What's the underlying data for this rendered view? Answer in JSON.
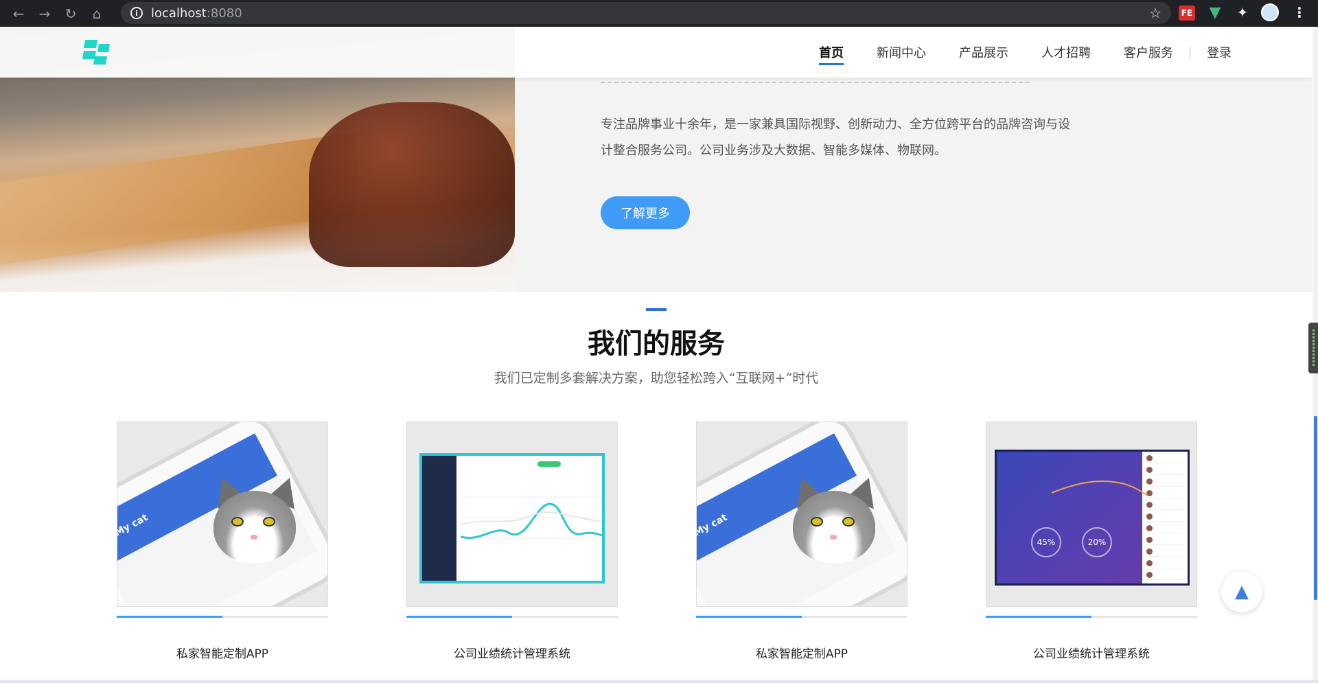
{
  "browser": {
    "url_host": "localhost",
    "url_port": ":8080",
    "ext_fe": "FE"
  },
  "nav": {
    "items": [
      "首页",
      "新闻中心",
      "产品展示",
      "人才招聘",
      "客户服务"
    ],
    "login": "登录"
  },
  "hero": {
    "text": "专注品牌事业十余年，是一家兼具国际视野、创新动力、全方位跨平台的品牌咨询与设计整合服务公司。公司业务涉及大数据、智能多媒体、物联网。",
    "button": "了解更多"
  },
  "services": {
    "title": "我们的服务",
    "subtitle": "我们已定制多套解决方案，助您轻松跨入“互联网+”时代",
    "cards": [
      {
        "title": "私家智能定制APP",
        "progress": 0.5
      },
      {
        "title": "公司业绩统计管理系统",
        "progress": 0.5
      },
      {
        "title": "私家智能定制APP",
        "progress": 0.5
      },
      {
        "title": "公司业绩统计管理系统",
        "progress": 0.5
      }
    ]
  },
  "illustrations": {
    "phone_caption": "My cat",
    "dash_rings": [
      "45%",
      "20%"
    ]
  },
  "colors": {
    "accent": "#3f9bf5",
    "active_nav": "#2b6fd8",
    "logo": "#1fd6c8"
  }
}
